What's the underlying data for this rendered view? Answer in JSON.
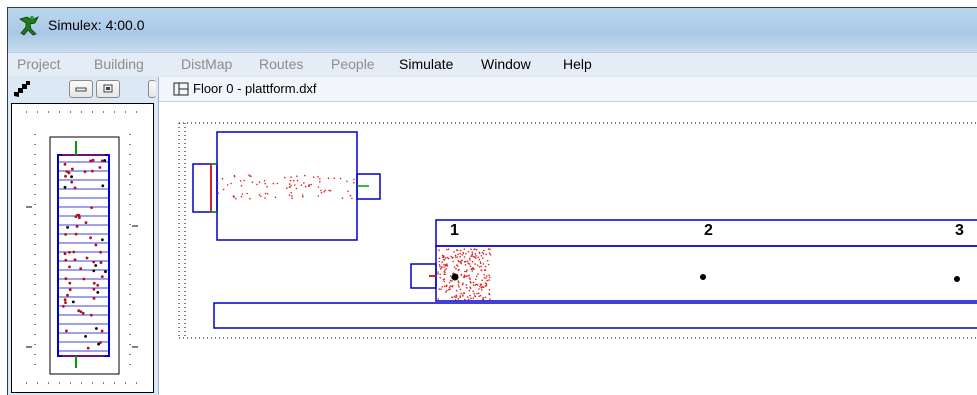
{
  "window": {
    "title": "Simulex: 4:00.0"
  },
  "menu": {
    "items": [
      {
        "label": "Project",
        "enabled": false
      },
      {
        "label": "Building",
        "enabled": false
      },
      {
        "label": "DistMap",
        "enabled": false
      },
      {
        "label": "Routes",
        "enabled": false
      },
      {
        "label": "People",
        "enabled": false
      },
      {
        "label": "Simulate",
        "enabled": true
      },
      {
        "label": "Window",
        "enabled": true
      },
      {
        "label": "Help",
        "enabled": true
      }
    ]
  },
  "toolbar": {
    "icons": [
      "stair-icon",
      "minimize-icon",
      "restore-icon"
    ]
  },
  "floor_window": {
    "title": "Floor 0 - plattform.dxf"
  },
  "exits": {
    "labels": [
      "1",
      "2",
      "3"
    ]
  },
  "colors": {
    "walls": "#0000cc",
    "people": "#e02020",
    "exit_red": "#e02020",
    "exit_green": "#00a000",
    "grid": "#000000"
  }
}
